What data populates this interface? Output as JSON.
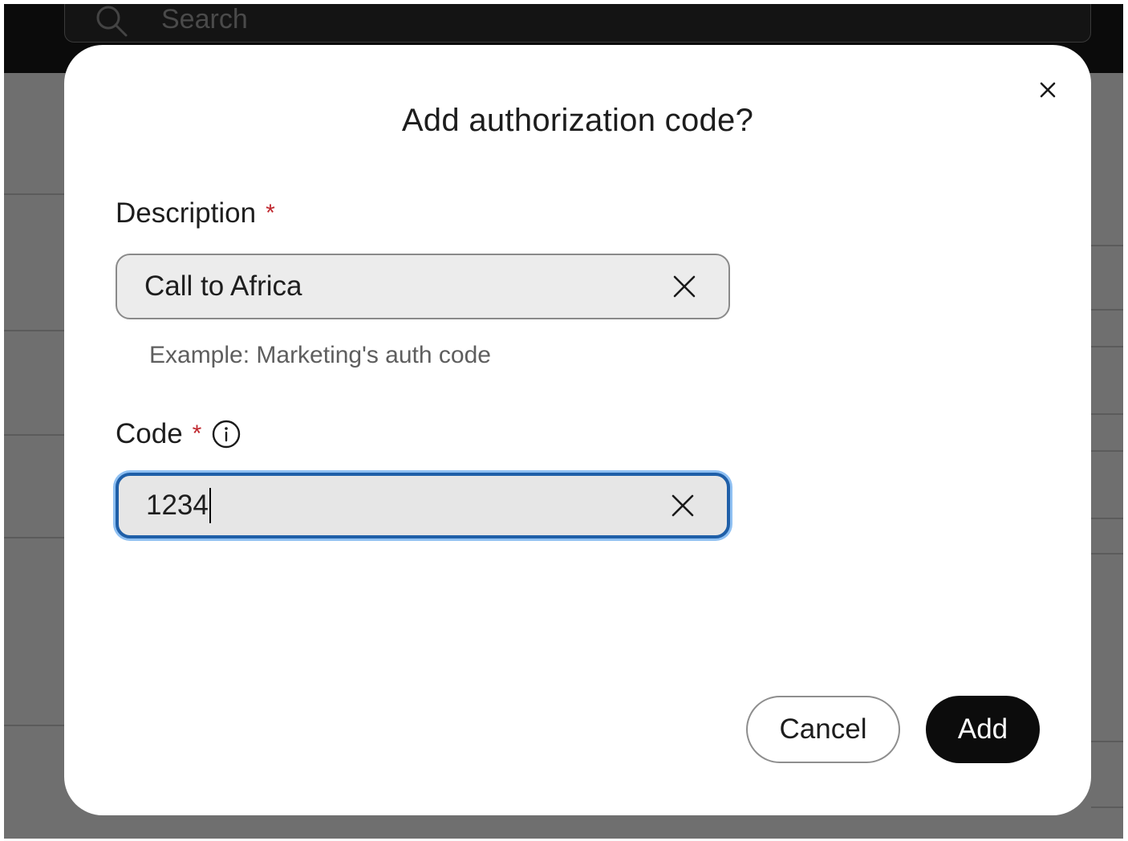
{
  "background": {
    "search_placeholder": "Search"
  },
  "dialog": {
    "title": "Add authorization code?",
    "description_field": {
      "label": "Description",
      "required_mark": "*",
      "value": "Call to Africa",
      "helper": "Example: Marketing's auth code"
    },
    "code_field": {
      "label": "Code",
      "required_mark": "*",
      "value": "1234",
      "focused": true
    },
    "buttons": {
      "cancel": "Cancel",
      "add": "Add"
    }
  },
  "icons": {
    "close": "close-icon",
    "clear": "clear-icon",
    "info": "info-icon",
    "search": "search-icon"
  },
  "colors": {
    "required": "#c0282f",
    "focus_ring": "#1f5fa8",
    "primary_button": "#0c0c0c",
    "backdrop": "#6f6f6f"
  }
}
